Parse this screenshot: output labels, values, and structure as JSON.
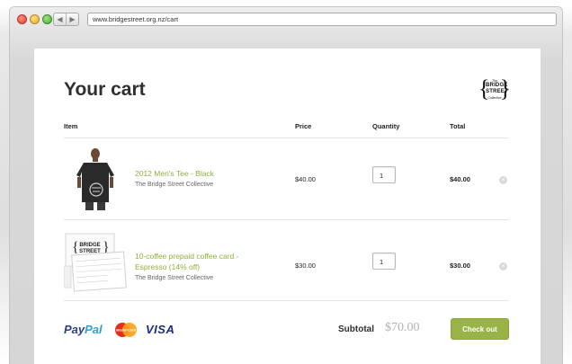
{
  "browser": {
    "url": "www.bridgestreet.org.nz/cart",
    "back_glyph": "◀",
    "forward_glyph": "▶"
  },
  "page": {
    "title": "Your cart",
    "logo": {
      "line1": "The",
      "line2": "BRIDGE",
      "line3": "STREET",
      "line4": "Collective",
      "brace_left": "{",
      "brace_right": "}"
    }
  },
  "table": {
    "headers": {
      "item": "Item",
      "price": "Price",
      "quantity": "Quantity",
      "total": "Total"
    },
    "rows": [
      {
        "name": "2012 Men's Tee - Black",
        "vendor": "The Bridge Street Collective",
        "price": "$40.00",
        "quantity": "1",
        "total": "$40.00",
        "thumb": "tshirt-image"
      },
      {
        "name": "10-coffee prepaid coffee card - Espresso (14% off)",
        "vendor": "The Bridge Street Collective",
        "price": "$30.00",
        "quantity": "1",
        "total": "$30.00",
        "thumb": "coffee-card-image"
      }
    ]
  },
  "footer": {
    "payments": {
      "paypal_a": "Pay",
      "paypal_b": "Pal",
      "mastercard": "MasterCard",
      "visa": "VISA"
    },
    "subtotal_label": "Subtotal",
    "subtotal_value": "$70.00",
    "checkout_label": "Check out"
  },
  "colors": {
    "accent_green": "#99b346",
    "link_green": "#8fb13c",
    "paypal_dark": "#2a3f84",
    "paypal_light": "#2aa0dd"
  }
}
